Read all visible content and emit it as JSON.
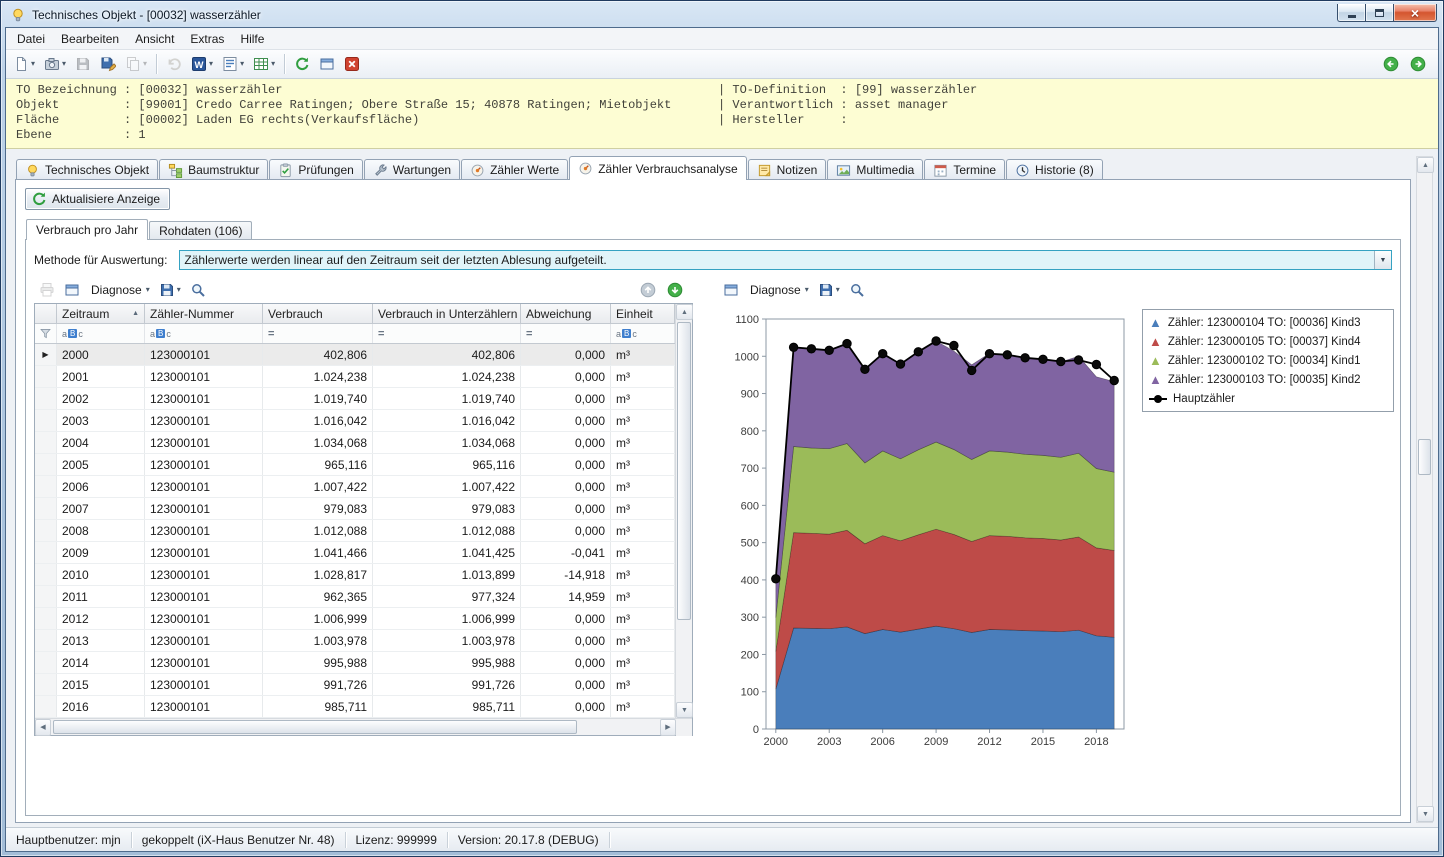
{
  "window": {
    "title": "Technisches Objekt - [00032] wasserzähler"
  },
  "menu": {
    "items": [
      "Datei",
      "Bearbeiten",
      "Ansicht",
      "Extras",
      "Hilfe"
    ]
  },
  "toolbar": {
    "buttons": [
      {
        "name": "new-document",
        "glyph": "page",
        "dropdown": true
      },
      {
        "name": "snapshot",
        "glyph": "camera",
        "dropdown": true
      },
      {
        "name": "save",
        "glyph": "disk",
        "enabled": false
      },
      {
        "name": "save-as",
        "glyph": "disk-edit"
      },
      {
        "name": "copy",
        "glyph": "copy",
        "dropdown": true,
        "enabled": false
      },
      {
        "sep": true
      },
      {
        "name": "undo",
        "glyph": "undo",
        "enabled": false
      },
      {
        "name": "word-export",
        "glyph": "word",
        "dropdown": true
      },
      {
        "name": "report-list",
        "glyph": "list",
        "dropdown": true
      },
      {
        "name": "excel-export",
        "glyph": "grid",
        "dropdown": true
      },
      {
        "sep": true
      },
      {
        "name": "refresh",
        "glyph": "refresh"
      },
      {
        "name": "detach-window",
        "glyph": "window"
      },
      {
        "name": "close-view",
        "glyph": "close"
      }
    ],
    "nav_buttons": [
      {
        "name": "nav-previous",
        "glyph": "circle-left"
      },
      {
        "name": "nav-next",
        "glyph": "circle-right"
      }
    ]
  },
  "info_panel": {
    "left_lines": [
      "TO Bezeichnung : [00032] wasserzähler",
      "Objekt         : [99001] Credo Carree Ratingen; Obere Straße 15; 40878 Ratingen; Mietobjekt",
      "Fläche         : [00002] Laden EG rechts(Verkaufsfläche)",
      "Ebene          : 1"
    ],
    "right_lines": [
      "| TO-Definition  : [99] wasserzähler",
      "| Verantwortlich : asset manager",
      "| Hersteller     :"
    ]
  },
  "tabs": [
    {
      "label": "Technisches Objekt",
      "icon": "bulb",
      "active": false
    },
    {
      "label": "Baumstruktur",
      "icon": "tree",
      "active": false
    },
    {
      "label": "Prüfungen",
      "icon": "clipboard",
      "active": false
    },
    {
      "label": "Wartungen",
      "icon": "wrench",
      "active": false
    },
    {
      "label": "Zähler Werte",
      "icon": "meter",
      "active": false
    },
    {
      "label": "Zähler Verbrauchsanalyse",
      "icon": "meter",
      "active": true
    },
    {
      "label": "Notizen",
      "icon": "note",
      "active": false
    },
    {
      "label": "Multimedia",
      "icon": "media",
      "active": false
    },
    {
      "label": "Termine",
      "icon": "calendar",
      "active": false
    },
    {
      "label": "Historie (8)",
      "icon": "history",
      "active": false
    }
  ],
  "content": {
    "refresh_button": "Aktualisiere Anzeige",
    "subtabs": [
      {
        "label": "Verbrauch pro Jahr",
        "active": true
      },
      {
        "label": "Rohdaten (106)",
        "active": false
      }
    ],
    "method_label": "Methode für Auswertung:",
    "method_value": "Zählerwerte werden linear auf den Zeitraum seit der letzten Ablesung aufgeteilt."
  },
  "grid": {
    "toolbar": {
      "buttons": [
        {
          "name": "print",
          "glyph": "printer",
          "enabled": false
        },
        {
          "name": "grid-detach",
          "glyph": "window"
        },
        {
          "name": "grid-diagnose",
          "label": "Diagnose",
          "dropdown": true
        },
        {
          "name": "grid-save-layout",
          "glyph": "disk",
          "dropdown": true
        },
        {
          "name": "grid-search",
          "glyph": "magnifier"
        }
      ],
      "right_buttons": [
        {
          "name": "grid-scroll-up",
          "glyph": "circle-up-gray"
        },
        {
          "name": "grid-scroll-down",
          "glyph": "circle-down-green"
        }
      ]
    },
    "columns": [
      {
        "label": "Zeitraum",
        "sort": "asc",
        "filter": "abc",
        "align": "left"
      },
      {
        "label": "Zähler-Nummer",
        "filter": "abc",
        "align": "left"
      },
      {
        "label": "Verbrauch",
        "filter": "eq",
        "align": "right"
      },
      {
        "label": "Verbrauch in Unterzählern",
        "filter": "eq",
        "align": "right"
      },
      {
        "label": "Abweichung",
        "filter": "eq",
        "align": "right"
      },
      {
        "label": "Einheit",
        "filter": "abc",
        "align": "left"
      }
    ],
    "rows": [
      [
        "2000",
        "123000101",
        "402,806",
        "402,806",
        "0,000",
        "m³"
      ],
      [
        "2001",
        "123000101",
        "1.024,238",
        "1.024,238",
        "0,000",
        "m³"
      ],
      [
        "2002",
        "123000101",
        "1.019,740",
        "1.019,740",
        "0,000",
        "m³"
      ],
      [
        "2003",
        "123000101",
        "1.016,042",
        "1.016,042",
        "0,000",
        "m³"
      ],
      [
        "2004",
        "123000101",
        "1.034,068",
        "1.034,068",
        "0,000",
        "m³"
      ],
      [
        "2005",
        "123000101",
        "965,116",
        "965,116",
        "0,000",
        "m³"
      ],
      [
        "2006",
        "123000101",
        "1.007,422",
        "1.007,422",
        "0,000",
        "m³"
      ],
      [
        "2007",
        "123000101",
        "979,083",
        "979,083",
        "0,000",
        "m³"
      ],
      [
        "2008",
        "123000101",
        "1.012,088",
        "1.012,088",
        "0,000",
        "m³"
      ],
      [
        "2009",
        "123000101",
        "1.041,466",
        "1.041,425",
        "-0,041",
        "m³"
      ],
      [
        "2010",
        "123000101",
        "1.028,817",
        "1.013,899",
        "-14,918",
        "m³"
      ],
      [
        "2011",
        "123000101",
        "962,365",
        "977,324",
        "14,959",
        "m³"
      ],
      [
        "2012",
        "123000101",
        "1.006,999",
        "1.006,999",
        "0,000",
        "m³"
      ],
      [
        "2013",
        "123000101",
        "1.003,978",
        "1.003,978",
        "0,000",
        "m³"
      ],
      [
        "2014",
        "123000101",
        "995,988",
        "995,988",
        "0,000",
        "m³"
      ],
      [
        "2015",
        "123000101",
        "991,726",
        "991,726",
        "0,000",
        "m³"
      ],
      [
        "2016",
        "123000101",
        "985,711",
        "985,711",
        "0,000",
        "m³"
      ]
    ],
    "selected_row": 0
  },
  "chart_panel": {
    "toolbar": {
      "buttons": [
        {
          "name": "chart-detach",
          "glyph": "window"
        },
        {
          "name": "chart-diagnose",
          "label": "Diagnose",
          "dropdown": true
        },
        {
          "name": "chart-save-layout",
          "glyph": "disk",
          "dropdown": true
        },
        {
          "name": "chart-search",
          "glyph": "magnifier"
        }
      ]
    }
  },
  "chart_data": {
    "type": "area",
    "stacked": true,
    "unit": "m³",
    "x": [
      2000,
      2001,
      2002,
      2003,
      2004,
      2005,
      2006,
      2007,
      2008,
      2009,
      2010,
      2011,
      2012,
      2013,
      2014,
      2015,
      2016,
      2017,
      2018,
      2019
    ],
    "xticks": [
      2000,
      2003,
      2006,
      2009,
      2012,
      2015,
      2018
    ],
    "ylim": [
      0,
      1100
    ],
    "ytick_step": 100,
    "legend_position": "top-right",
    "series": [
      {
        "name": "Zähler: 123000104 TO: [00036] Kind3",
        "color": "#4a7ebb",
        "values": [
          107,
          271,
          270,
          269,
          274,
          256,
          267,
          260,
          268,
          276,
          269,
          259,
          267,
          266,
          264,
          263,
          261,
          265,
          250,
          246
        ]
      },
      {
        "name": "Zähler: 123000105 TO: [00037] Kind4",
        "color": "#be4b48",
        "values": [
          101,
          256,
          255,
          254,
          259,
          241,
          252,
          245,
          253,
          260,
          253,
          244,
          252,
          251,
          249,
          248,
          246,
          250,
          236,
          233
        ]
      },
      {
        "name": "Zähler: 123000102 TO: [00034] Kind1",
        "color": "#9bbb59",
        "values": [
          91,
          231,
          229,
          229,
          233,
          217,
          227,
          220,
          228,
          234,
          228,
          220,
          227,
          226,
          224,
          223,
          222,
          225,
          213,
          210
        ]
      },
      {
        "name": "Zähler: 123000103 TO: [00035] Kind2",
        "color": "#8064a2",
        "values": [
          105,
          266,
          265,
          264,
          269,
          251,
          262,
          255,
          263,
          271,
          264,
          254,
          262,
          261,
          259,
          258,
          256,
          260,
          246,
          243
        ]
      }
    ],
    "line_series": {
      "name": "Hauptzähler",
      "color": "#000000",
      "values": [
        403,
        1024,
        1020,
        1016,
        1034,
        965,
        1007,
        979,
        1012,
        1041,
        1029,
        962,
        1007,
        1004,
        996,
        992,
        986,
        990,
        978,
        935
      ]
    }
  },
  "statusbar": {
    "items": [
      "Hauptbenutzer: mjn",
      "gekoppelt (iX-Haus Benutzer Nr. 48)",
      "Lizenz: 999999",
      "Version: 20.17.8 (DEBUG)"
    ]
  }
}
